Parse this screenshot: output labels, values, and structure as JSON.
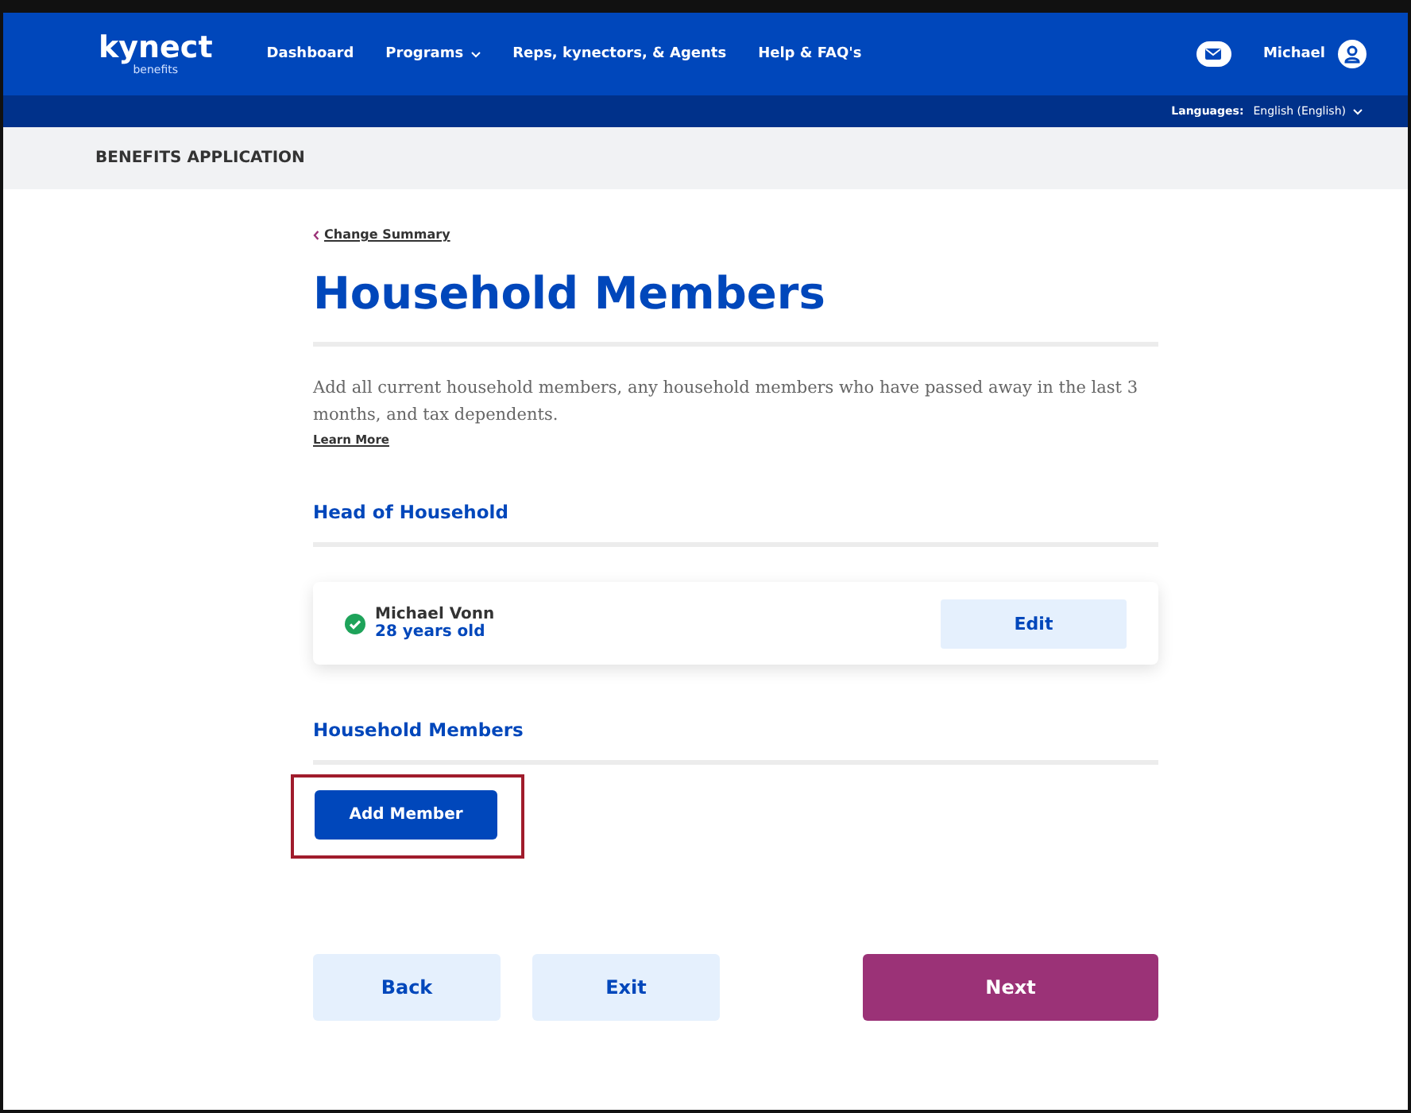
{
  "header": {
    "logo": "kynect",
    "logo_sub": "benefits",
    "nav": [
      {
        "label": "Dashboard",
        "dropdown": false
      },
      {
        "label": "Programs",
        "dropdown": true
      },
      {
        "label": "Reps, kynectors, & Agents",
        "dropdown": false
      },
      {
        "label": "Help & FAQ's",
        "dropdown": false
      }
    ],
    "user": "Michael"
  },
  "language_bar": {
    "label": "Languages:",
    "value": "English (English)"
  },
  "page_bar": {
    "title": "BENEFITS APPLICATION"
  },
  "back_link": "Change Summary",
  "title": "Household Members",
  "intro": "Add all current household members, any household members who have passed away in the last 3 months, and tax dependents.",
  "learn_more": "Learn More",
  "head_section": {
    "title": "Head of Household",
    "member": {
      "name": "Michael Vonn",
      "age": "28 years old",
      "complete": true,
      "action": "Edit"
    }
  },
  "members_section": {
    "title": "Household Members",
    "add_button": {
      "label": "Add Member",
      "highlighted": true
    }
  },
  "footer_buttons": [
    {
      "label": "Back",
      "kind": "secondary"
    },
    {
      "label": "Exit",
      "kind": "secondary"
    },
    {
      "label": "Next",
      "kind": "primary"
    }
  ]
}
